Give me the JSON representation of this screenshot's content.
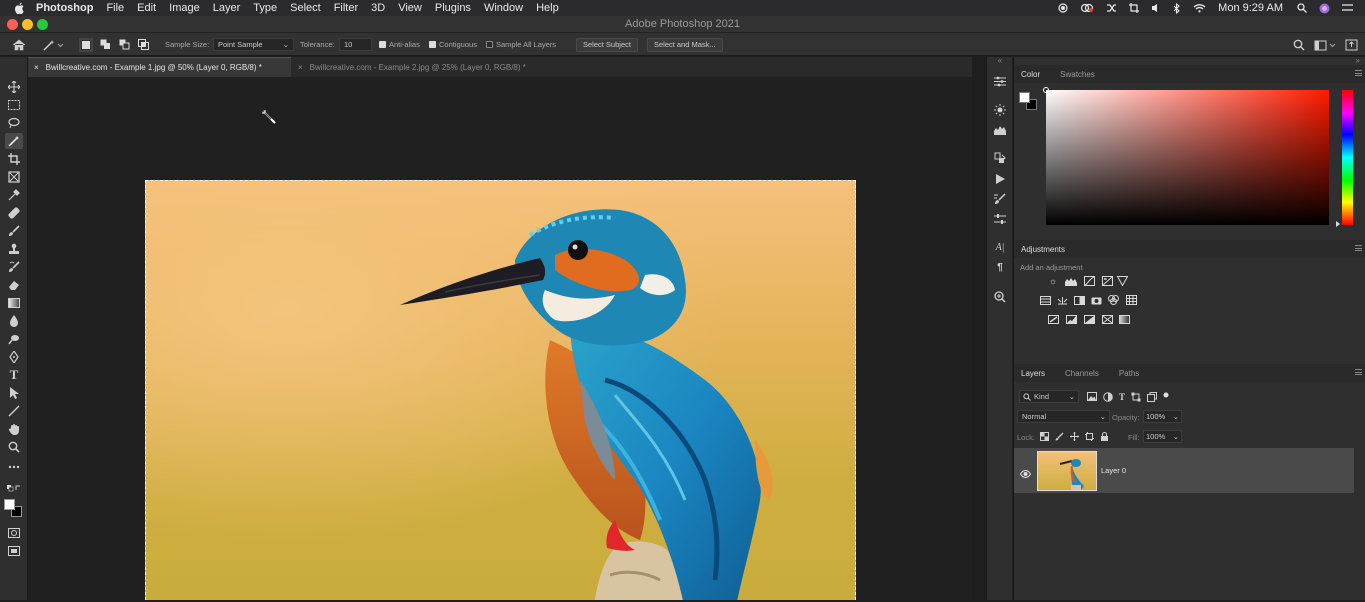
{
  "menubar": {
    "app": "Photoshop",
    "items": [
      "File",
      "Edit",
      "Image",
      "Layer",
      "Type",
      "Select",
      "Filter",
      "3D",
      "View",
      "Plugins",
      "Window",
      "Help"
    ],
    "clock": "Mon 9:29 AM"
  },
  "window": {
    "title": "Adobe Photoshop 2021"
  },
  "options": {
    "sample_size_label": "Sample Size:",
    "sample_size_value": "Point Sample",
    "tolerance_label": "Tolerance:",
    "tolerance_value": "10",
    "anti_alias": "Anti-alias",
    "contiguous": "Contiguous",
    "sample_all_layers": "Sample All Layers",
    "select_subject": "Select Subject",
    "select_and_mask": "Select and Mask..."
  },
  "tabs": [
    {
      "label": "Bwillcreative.com - Example 1.jpg @ 50% (Layer 0, RGB/8) *",
      "active": true
    },
    {
      "label": "Bwillcreative.com - Example 2.jpg @ 25% (Layer 0, RGB/8) *",
      "active": false
    }
  ],
  "color_panel": {
    "tabs": [
      "Color",
      "Swatches"
    ]
  },
  "adjustments_panel": {
    "title": "Adjustments",
    "hint": "Add an adjustment"
  },
  "layers_panel": {
    "tabs": [
      "Layers",
      "Channels",
      "Paths"
    ],
    "filter": "Kind",
    "blend_mode": "Normal",
    "opacity_label": "Opacity:",
    "opacity_value": "100%",
    "lock_label": "Lock:",
    "fill_label": "Fill:",
    "fill_value": "100%",
    "layers": [
      {
        "name": "Layer 0"
      }
    ]
  },
  "colors": {
    "accent_red_light": "#ff5f57",
    "accent_yellow_light": "#febc2e",
    "accent_green_light": "#28c840",
    "panel_bg": "#2f2f2f",
    "canvas_bg": "#202020"
  }
}
